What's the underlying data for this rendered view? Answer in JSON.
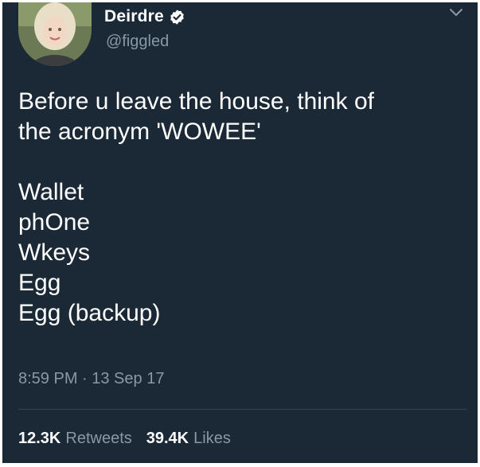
{
  "author": {
    "display_name": "Deirdre",
    "handle": "@figgled",
    "verified": true
  },
  "icons": {
    "verified": "verified-badge-icon",
    "menu": "chevron-down-icon"
  },
  "tweet": {
    "lines_intro": [
      "Before u leave the house, think of",
      "the acronym 'WOWEE'"
    ],
    "list": [
      "Wallet",
      "phOne",
      "Wkeys",
      "Egg",
      "Egg (backup)"
    ],
    "timestamp": "8:59 PM · 13 Sep 17"
  },
  "stats": {
    "retweets_count": "12.3K",
    "retweets_label": "Retweets",
    "likes_count": "39.4K",
    "likes_label": "Likes"
  },
  "colors": {
    "background": "#1b2836",
    "text": "#ffffff",
    "muted": "#8899a6",
    "verified": "#ffffff"
  }
}
